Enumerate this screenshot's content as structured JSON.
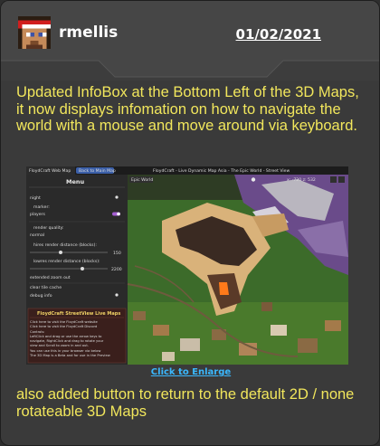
{
  "post": {
    "username": "rmellis",
    "date": "01/02/2021",
    "paragraph1": "Updated InfoBox at the Bottom Left of the 3D Maps, it now displays infomation on how to navigate the world with a mouse and move around via keyboard.",
    "enlarge_link": "Click to Enlarge",
    "paragraph2": "also added button to return to the default 2D / none rotateable 3D Maps"
  },
  "colors": {
    "text_yellow": "#f1e65c",
    "link_blue": "#3ab8ff",
    "card_bg": "#3a3a3a"
  },
  "screenshot": {
    "tab_left": "FloydCraft Web Map",
    "tab_back": "Back to Main Map",
    "window_title": "FloydCraft - Live Dynamic Map Asia - The Epic World - Street View",
    "menu_title": "Menu",
    "world_label": "Epic World",
    "coords": "x: -720   z: 532",
    "rows": {
      "night": "night",
      "marker": "marker:",
      "players": "players",
      "render_quality": "render quality:",
      "normal": "normal",
      "hires_distance": "hires render distance (blocks):",
      "hires_value": "150",
      "lowres_distance": "lowres render distance (blocks):",
      "lowres_value": "2200",
      "extended_zoom": "extended zoom out",
      "clear_tile_cache": "clear tile cache",
      "debug_info": "debug info"
    },
    "infobox": {
      "title": "FloydCraft StreetView Live Maps",
      "line1": "Click here to visit the FloydCraft website",
      "line2": "Click here to visit the FloydCraft Discord",
      "line3": "Controls:",
      "line4": "LeftClick and drag or use the arrow keys to",
      "line5": "navigate, RightClick and drag to rotate your",
      "line6": "view and Scroll to zoom in and out.",
      "line7": "You can use this in your browser via below",
      "line8": "The 3D Map is a Beta and for use in the Preview"
    }
  }
}
